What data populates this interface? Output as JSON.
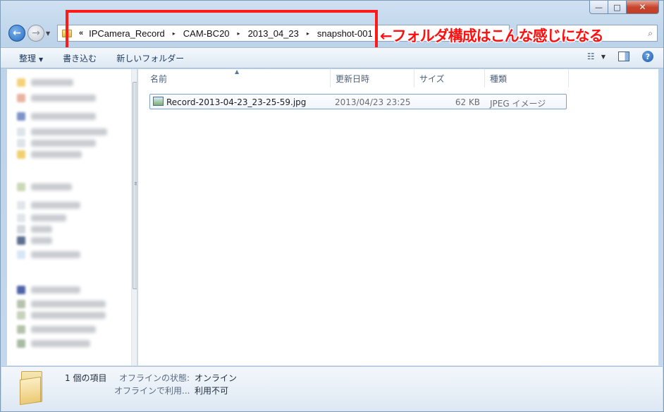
{
  "window": {
    "caption": {
      "minimize": "—",
      "maximize": "□",
      "close": "✕"
    }
  },
  "address": {
    "overflow": "«",
    "crumbs": [
      "IPCamera_Record",
      "CAM-BC20",
      "2013_04_23",
      "snapshot-001"
    ],
    "separator": "▸"
  },
  "search": {
    "placeholder": ""
  },
  "annotation": {
    "text": "←フォルダ構成はこんな感じになる",
    "color": "#ff1010"
  },
  "toolbar": {
    "organize": "整理",
    "burn": "書き込む",
    "new_folder": "新しいフォルダー"
  },
  "columns": {
    "name": "名前",
    "modified": "更新日時",
    "size": "サイズ",
    "type": "種類"
  },
  "files": [
    {
      "name": "Record-2013-04-23_23-25-59.jpg",
      "modified": "2013/04/23 23:25",
      "size": "62 KB",
      "type": "JPEG イメージ",
      "icon": "jpg-image-icon"
    }
  ],
  "status": {
    "count": "1 個の項目",
    "offline_status_label": "オフラインの状態:",
    "offline_status_value": "オンライン",
    "offline_use_label": "オフラインで利用...",
    "offline_use_value": "利用不可"
  },
  "colors": {
    "selection_border": "#7da2ce",
    "annotation": "#ff1a1a",
    "chrome": "#c6d8ec"
  }
}
